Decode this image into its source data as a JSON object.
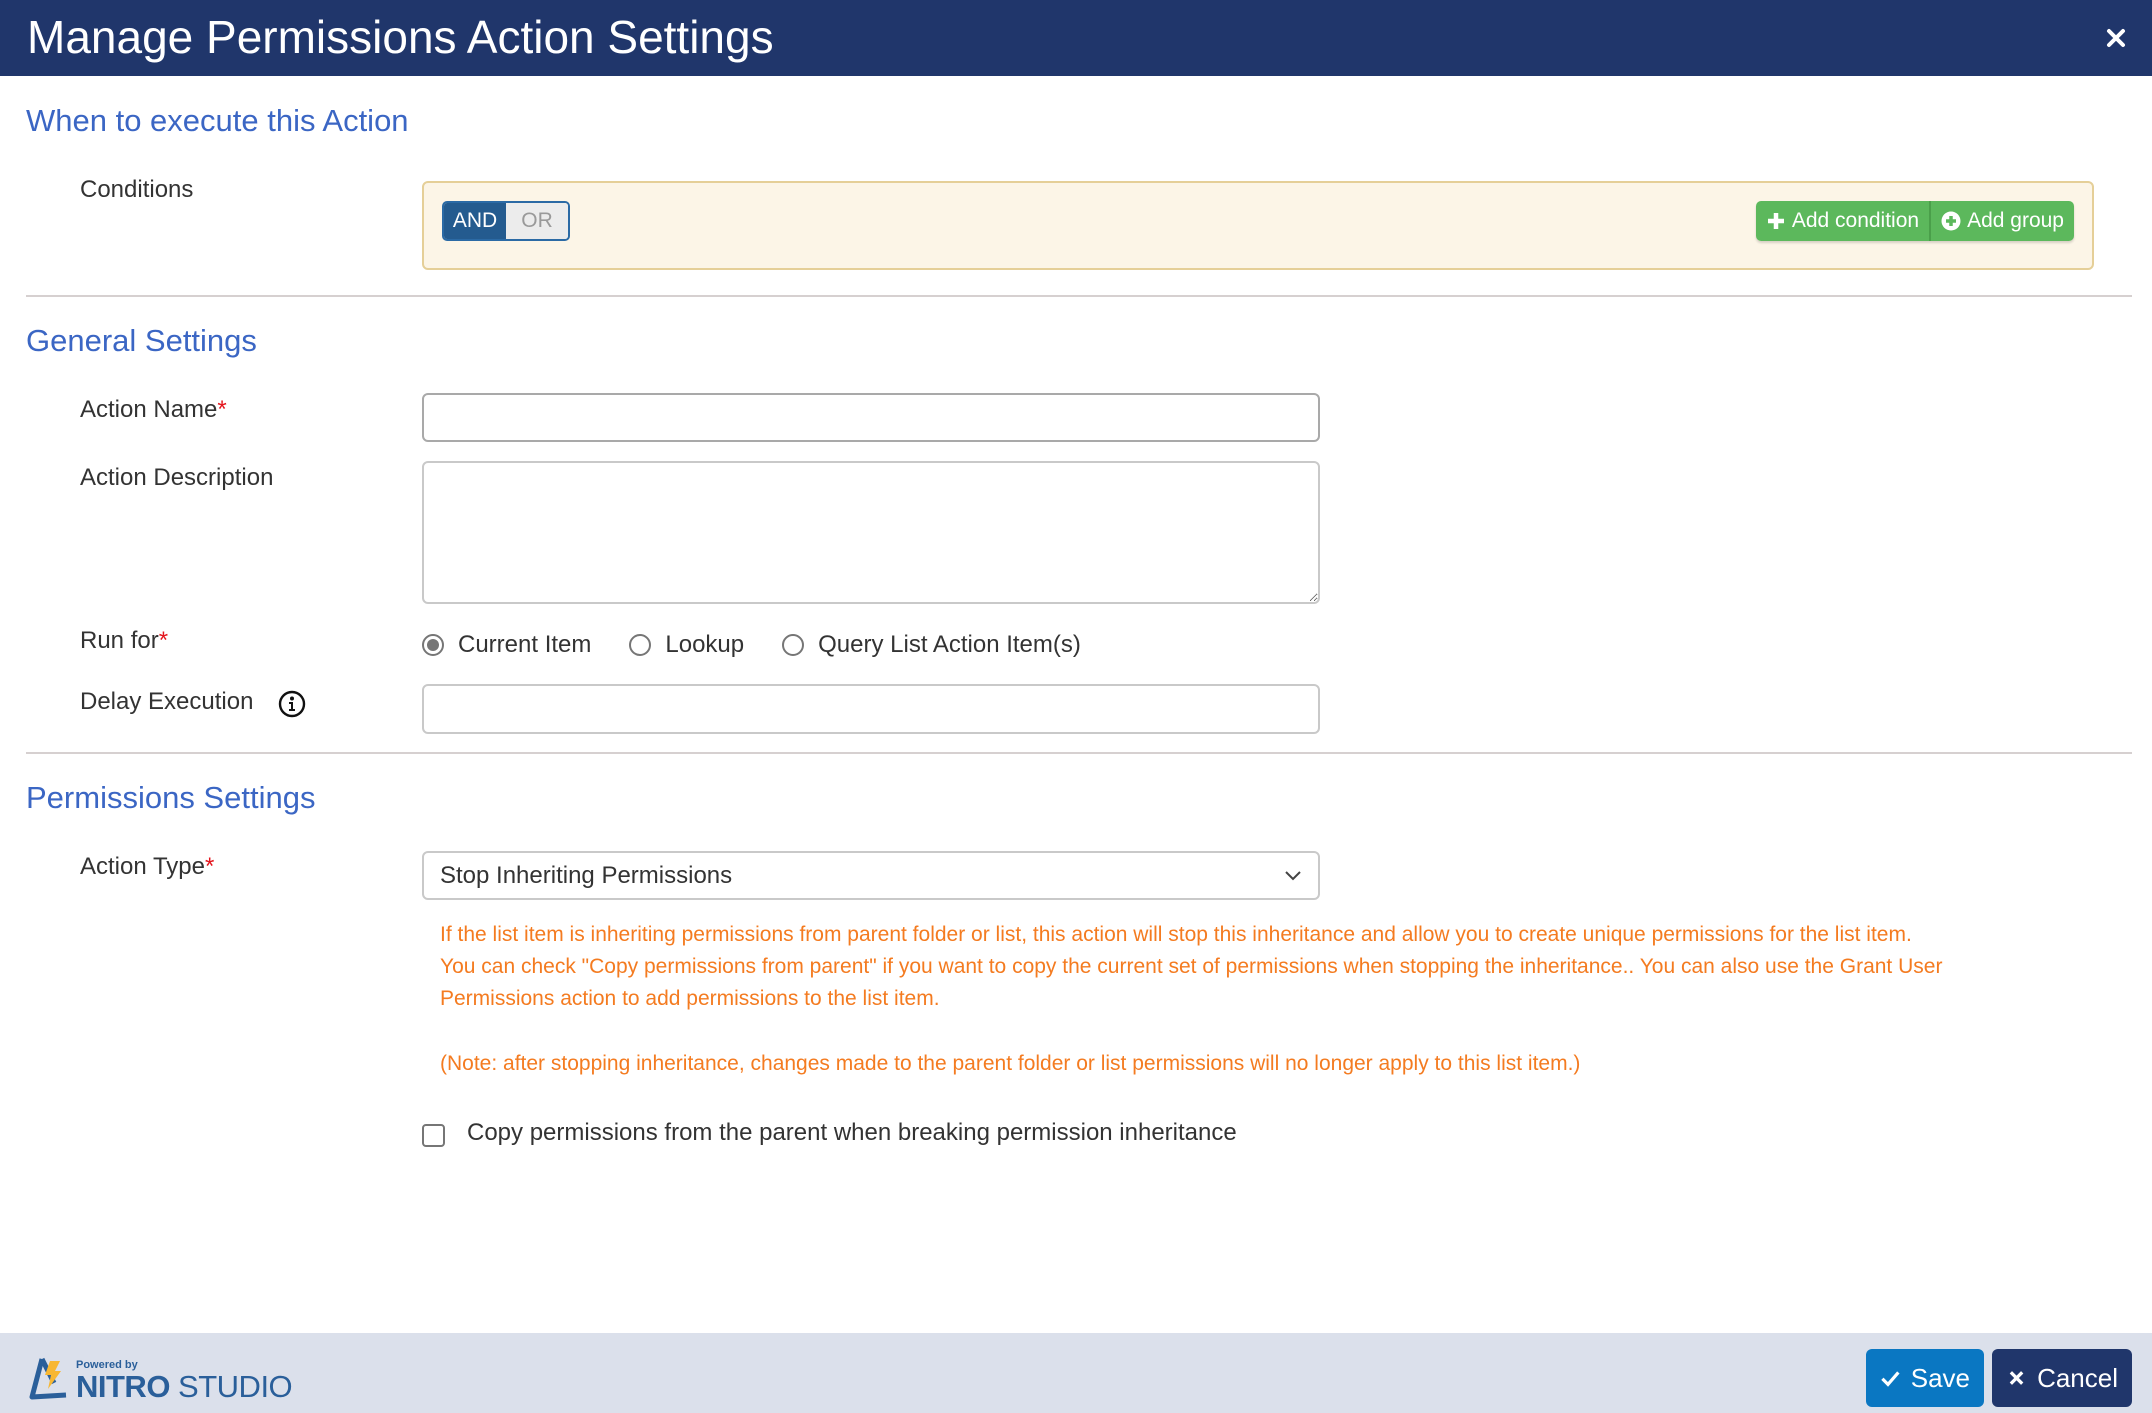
{
  "dialog": {
    "title": "Manage Permissions Action Settings",
    "close_icon": "close-icon"
  },
  "sections": {
    "when": {
      "title": "When to execute this Action",
      "conditions_label": "Conditions",
      "logic_toggle": {
        "options": [
          "AND",
          "OR"
        ],
        "selected": "AND"
      },
      "add_condition_label": "Add condition",
      "add_group_label": "Add group"
    },
    "general": {
      "title": "General Settings",
      "action_name": {
        "label": "Action Name",
        "required": "*",
        "value": "",
        "placeholder": ""
      },
      "action_description": {
        "label": "Action Description",
        "value": "",
        "placeholder": ""
      },
      "run_for": {
        "label": "Run for",
        "required": "*",
        "options": [
          "Current Item",
          "Lookup",
          "Query List Action Item(s)"
        ],
        "selected": "Current Item"
      },
      "delay_execution": {
        "label": "Delay Execution",
        "value": "",
        "info_icon": "info-icon"
      }
    },
    "permissions": {
      "title": "Permissions Settings",
      "action_type": {
        "label": "Action Type",
        "required": "*",
        "selected": "Stop Inheriting Permissions"
      },
      "help_lines": [
        "If the list item is inheriting permissions from parent folder or list, this action will stop this inheritance and allow you to create unique permissions for the list item.",
        "You can check \"Copy permissions from parent\" if you want to copy the current set of permissions when stopping the inheritance.. You can also use the Grant User",
        "Permissions action to add permissions to the list item."
      ],
      "note": "(Note: after stopping inheritance, changes made to the parent folder or list permissions will no longer apply to this list item.)",
      "copy_checkbox": {
        "label": "Copy permissions from the parent when breaking permission inheritance",
        "checked": false
      }
    }
  },
  "footer": {
    "logo": {
      "powered_by": "Powered by",
      "brand_bold": "NITRO",
      "brand_light": " STUDIO"
    },
    "save_label": "Save",
    "cancel_label": "Cancel"
  },
  "colors": {
    "header_bg": "#20366b",
    "section_title": "#3b66c4",
    "required": "#e4151d",
    "help_text": "#f47b20",
    "add_button": "#5cb85c",
    "save_button": "#0a77c2",
    "cancel_button": "#20366b"
  }
}
